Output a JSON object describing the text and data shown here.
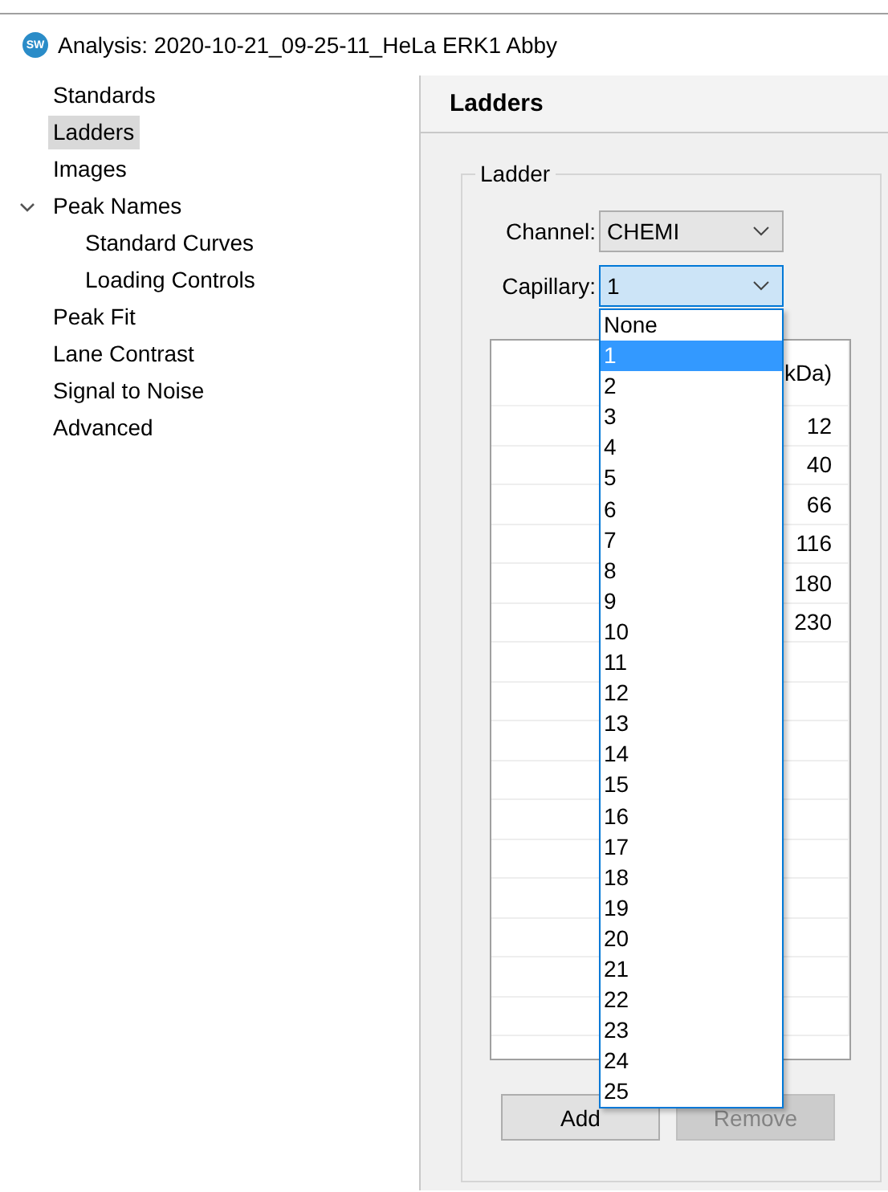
{
  "window": {
    "icon_text": "SW",
    "title": "Analysis: 2020-10-21_09-25-11_HeLa ERK1 Abby"
  },
  "sidebar": {
    "items": [
      {
        "label": "Standards",
        "selected": false
      },
      {
        "label": "Ladders",
        "selected": true
      },
      {
        "label": "Images",
        "selected": false
      },
      {
        "label": "Peak Names",
        "selected": false,
        "expanded": true,
        "children": [
          {
            "label": "Standard Curves",
            "selected": false
          },
          {
            "label": "Loading Controls",
            "selected": false
          }
        ]
      },
      {
        "label": "Peak Fit",
        "selected": false
      },
      {
        "label": "Lane Contrast",
        "selected": false
      },
      {
        "label": "Signal to Noise",
        "selected": false
      },
      {
        "label": "Advanced",
        "selected": false
      }
    ]
  },
  "panel": {
    "title": "Ladders",
    "group": "Ladder",
    "channel": {
      "label": "Channel:",
      "value": "CHEMI"
    },
    "capillary": {
      "label": "Capillary:",
      "value": "1",
      "expanded": true,
      "options": [
        {
          "label": "None",
          "selected": false
        },
        {
          "label": "1",
          "selected": true
        },
        {
          "label": "2",
          "selected": false
        },
        {
          "label": "3",
          "selected": false
        },
        {
          "label": "4",
          "selected": false
        },
        {
          "label": "5",
          "selected": false
        },
        {
          "label": "6",
          "selected": false
        },
        {
          "label": "7",
          "selected": false
        },
        {
          "label": "8",
          "selected": false
        },
        {
          "label": "9",
          "selected": false
        },
        {
          "label": "10",
          "selected": false
        },
        {
          "label": "11",
          "selected": false
        },
        {
          "label": "12",
          "selected": false
        },
        {
          "label": "13",
          "selected": false
        },
        {
          "label": "14",
          "selected": false
        },
        {
          "label": "15",
          "selected": false
        },
        {
          "label": "16",
          "selected": false
        },
        {
          "label": "17",
          "selected": false
        },
        {
          "label": "18",
          "selected": false
        },
        {
          "label": "19",
          "selected": false
        },
        {
          "label": "20",
          "selected": false
        },
        {
          "label": "21",
          "selected": false
        },
        {
          "label": "22",
          "selected": false
        },
        {
          "label": "23",
          "selected": false
        },
        {
          "label": "24",
          "selected": false
        },
        {
          "label": "25",
          "selected": false
        }
      ]
    },
    "table": {
      "columns": [
        "kDa)"
      ],
      "rows": [
        "12",
        "40",
        "66",
        "116",
        "180",
        "230"
      ]
    },
    "buttons": [
      {
        "label": "Add",
        "disabled": false
      },
      {
        "label": "Remove",
        "disabled": true
      }
    ]
  }
}
